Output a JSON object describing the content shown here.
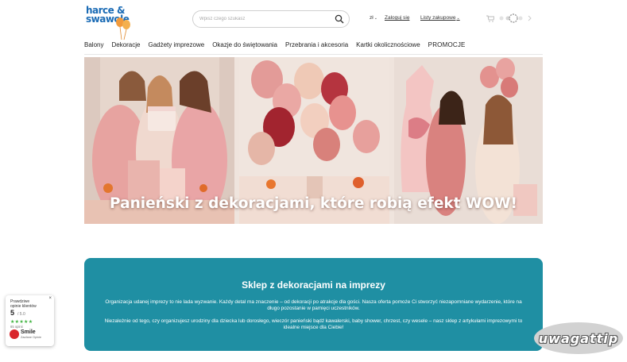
{
  "header": {
    "logo_line1": "harce &",
    "logo_line2": "swawole",
    "search_placeholder": "Wpisz czego szukasz",
    "currency": "zł",
    "login": "Zaloguj się",
    "shopping_lists": "Listy zakupowe"
  },
  "nav": {
    "items": [
      "Balony",
      "Dekoracje",
      "Gadżety imprezowe",
      "Okazje do świętowania",
      "Przebrania i akcesoria",
      "Kartki okolicznościowe",
      "PROMOCJE"
    ]
  },
  "hero": {
    "title": "Panieński z dekoracjami, które robią efekt WOW!"
  },
  "info": {
    "heading": "Sklep z dekoracjami na imprezy",
    "paragraph1": "Organizacja udanej imprezy to nie lada wyzwanie. Każdy detal ma znaczenie – od dekoracji po atrakcje dla gości. Nasza oferta pomoże Ci stworzyć niezapomniane wydarzenie, które na długo pozostanie w pamięci uczestników.",
    "paragraph2": "Niezależnie od tego, czy organizujesz urodziny dla dziecka lub dorosłego, wieczór panieński bądź kawalerski, baby shower, chrzest, czy wesele – nasz sklep z artykułami imprezowymi to idealne miejsce dla Ciebie!"
  },
  "reviews": {
    "title_line1": "Prawdziwe",
    "title_line2": "opinie klientów",
    "score": "5",
    "out_of": "/ 5.0",
    "stars": "★★★★★",
    "count": "65 opinii",
    "brand": "Smile",
    "brand_sub": "Zaufane Opinie",
    "close": "×"
  },
  "watermark": "uwagattip",
  "colors": {
    "brand_blue": "#1a6bb5",
    "info_bg": "#1f8fa3",
    "stars_green": "#3db23d"
  }
}
